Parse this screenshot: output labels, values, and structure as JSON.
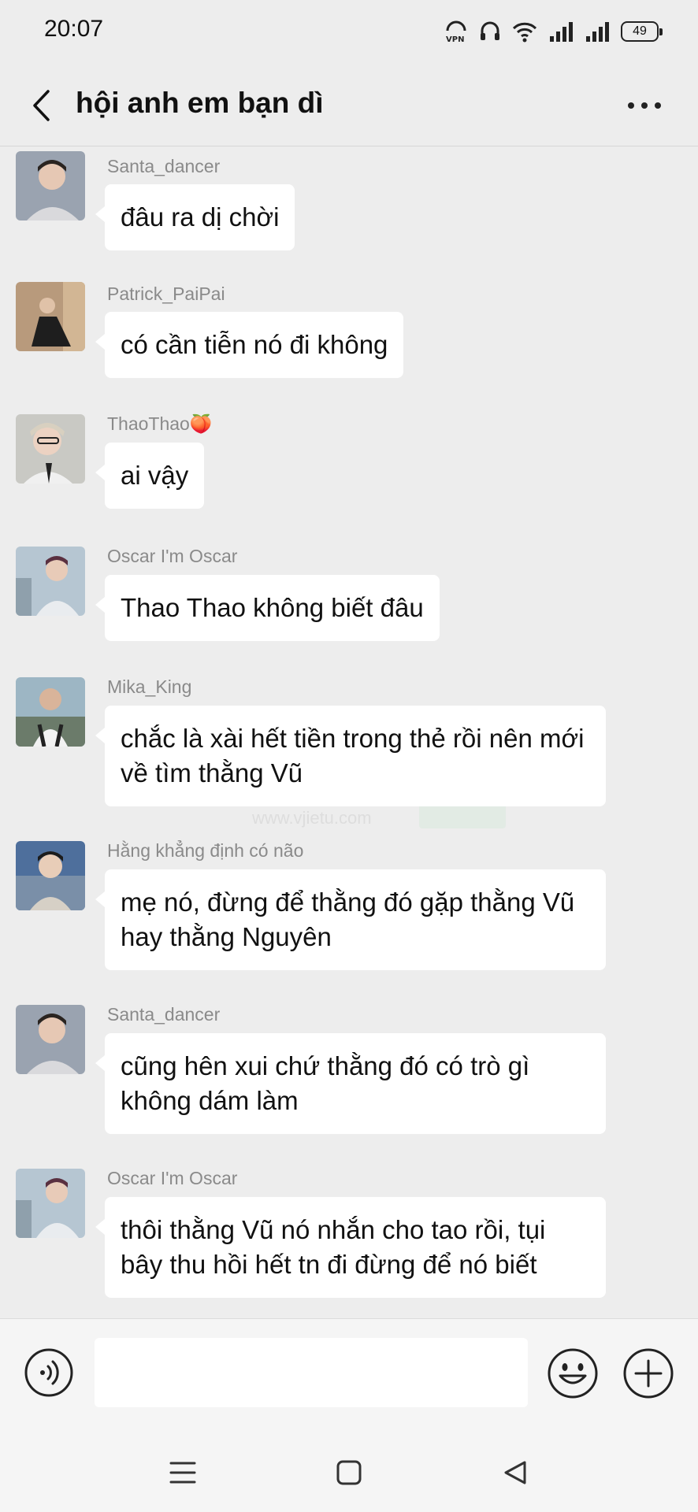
{
  "status_bar": {
    "time": "20:07",
    "battery": "49"
  },
  "header": {
    "title": "hội anh em bạn dì"
  },
  "messages": [
    {
      "sender": "Santa_dancer",
      "text": "đâu ra dị chời"
    },
    {
      "sender": "Patrick_PaiPai",
      "text": "có cần tiễn nó đi không"
    },
    {
      "sender": "ThaoThao🍑",
      "text": "ai vậy"
    },
    {
      "sender": "Oscar I'm Oscar",
      "text": "Thao Thao không biết đâu"
    },
    {
      "sender": "Mika_King",
      "text": "chắc là xài hết tiền trong thẻ rồi nên mới về tìm thằng Vũ"
    },
    {
      "sender": "Hằng khẳng định có não",
      "text": "mẹ nó, đừng để thằng đó gặp thằng Vũ hay thằng Nguyên"
    },
    {
      "sender": "Santa_dancer",
      "text": "cũng hên xui chứ thằng đó có trò gì không dám làm"
    },
    {
      "sender": "Oscar I'm Oscar",
      "text": "thôi thằng Vũ nó nhắn cho tao rồi, tụi bây thu hồi hết tn đi đừng để nó biết"
    }
  ],
  "watermark": {
    "text": "微截图",
    "url": "www.vjietu.com"
  },
  "input": {
    "value": "",
    "placeholder": ""
  },
  "colors": {
    "background": "#ededed",
    "bubble": "#ffffff",
    "sender_name": "#8a8a8a"
  }
}
